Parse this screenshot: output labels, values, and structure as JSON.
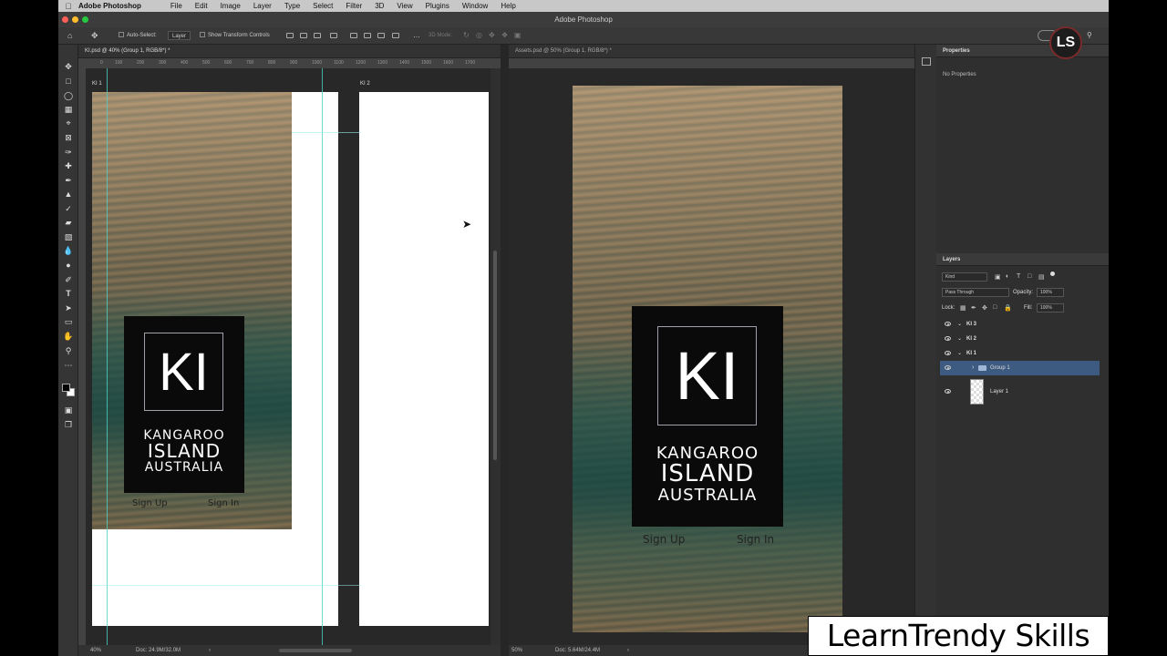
{
  "menubar": {
    "app_name": "Adobe Photoshop",
    "items": [
      "File",
      "Edit",
      "Image",
      "Layer",
      "Type",
      "Select",
      "Filter",
      "3D",
      "View",
      "Plugins",
      "Window",
      "Help"
    ]
  },
  "window": {
    "title": "Adobe Photoshop"
  },
  "options_bar": {
    "auto_select_label": "Auto-Select:",
    "auto_select_value": "Layer",
    "transform_label": "Show Transform Controls",
    "mode_label": "3D Mode:"
  },
  "left_doc": {
    "tab": "KI.psd @ 40% (Group 1, RGB/8*) *",
    "ruler_ticks": [
      "0",
      "100",
      "200",
      "300",
      "400",
      "500",
      "600",
      "700",
      "800",
      "900",
      "1000",
      "1100",
      "1200",
      "1300",
      "1400",
      "1500",
      "1600",
      "1700"
    ],
    "artboard1_label": "KI 1",
    "artboard2_label": "KI 2",
    "logo": {
      "mark": "KI",
      "line1": "KANGAROO",
      "line2": "ISLAND",
      "line3": "AUSTRALIA"
    },
    "sign_up": "Sign Up",
    "sign_in": "Sign In",
    "zoom": "40%",
    "doc_info": "Doc: 24.9M/32.0M"
  },
  "right_doc": {
    "tab": "Assets.psd @ 50% (Group 1, RGB/8*) *",
    "logo": {
      "mark": "KI",
      "line1": "KANGAROO",
      "line2": "ISLAND",
      "line3": "AUSTRALIA"
    },
    "sign_up": "Sign Up",
    "sign_in": "Sign In",
    "zoom": "50%",
    "doc_info": "Doc: 5.64M/24.4M"
  },
  "properties": {
    "title": "Properties",
    "empty": "No Properties"
  },
  "layers": {
    "title": "Layers",
    "filter": "Kind",
    "blend": "Pass Through",
    "opacity_label": "Opacity:",
    "opacity": "100%",
    "lock_label": "Lock:",
    "fill_label": "Fill:",
    "fill": "100%",
    "rows": [
      {
        "name": "KI 3"
      },
      {
        "name": "KI 2"
      },
      {
        "name": "KI 1"
      },
      {
        "name": "Group 1"
      },
      {
        "name": "Layer 1"
      }
    ]
  },
  "watermark": {
    "text": "LearnTrendy Skills"
  },
  "colors": {
    "accent": "#3d5a80",
    "guide": "#4fd1c5",
    "canvas_bg": "#282828"
  }
}
